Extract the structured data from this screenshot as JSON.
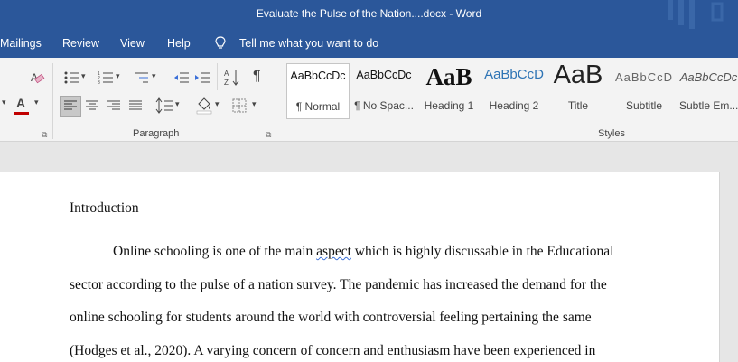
{
  "window": {
    "title": "Evaluate the Pulse of the Nation....docx  -  Word"
  },
  "menu": {
    "items": [
      "Mailings",
      "Review",
      "View",
      "Help"
    ],
    "tell_me": "Tell me what you want to do"
  },
  "ribbon": {
    "paragraph_label": "Paragraph",
    "styles_label": "Styles",
    "styles": [
      {
        "preview": "AaBbCcDc",
        "name": "¶ Normal"
      },
      {
        "preview": "AaBbCcDc",
        "name": "¶ No Spac..."
      },
      {
        "preview": "AaB",
        "name": "Heading 1"
      },
      {
        "preview": "AaBbCcD",
        "name": "Heading 2"
      },
      {
        "preview": "AaB",
        "name": "Title"
      },
      {
        "preview": "AaBbCcD",
        "name": "Subtitle"
      },
      {
        "preview": "AaBbCcDc",
        "name": "Subtle Em..."
      }
    ]
  },
  "document": {
    "heading": "Introduction",
    "line1_pre": "Online schooling is one of the main ",
    "line1_err": "aspect",
    "line1_post": " which is highly discussable in the Educational",
    "line2": "sector according to the pulse of a nation survey. The pandemic has increased the demand for the",
    "line3": "online schooling for students around the world with controversial feeling pertaining the same",
    "line4": "(Hodges et al., 2020). A varying concern of concern and enthusiasm have been experienced in"
  },
  "colors": {
    "titlebar": "#2b579a",
    "ribbon": "#f3f3f3",
    "accent_red": "#c00000"
  }
}
